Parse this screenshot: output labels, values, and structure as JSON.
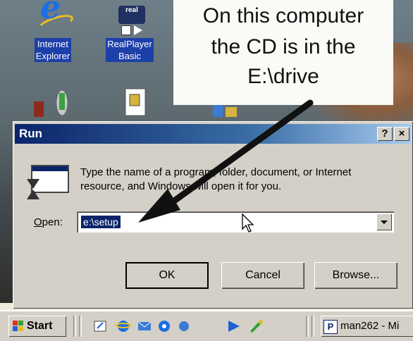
{
  "desktop": {
    "icons": [
      {
        "label_line1": "Internet",
        "label_line2": "Explorer",
        "icon": "internet-explorer-icon"
      },
      {
        "label_line1": "RealPlayer",
        "label_line2": "Basic",
        "icon": "realplayer-icon",
        "badge": "real"
      }
    ]
  },
  "callout": {
    "line1": "On this computer",
    "line2": "the CD is in the",
    "line3": "E:\\drive"
  },
  "run_dialog": {
    "title": "Run",
    "help_label": "?",
    "close_label": "×",
    "description_line1": "Type the name of a program, folder, document, or Internet",
    "description_line2": "resource, and Windows will open it for you.",
    "open_label": "Open:",
    "open_value": "e:\\setup",
    "ok_label": "OK",
    "cancel_label": "Cancel",
    "browse_label": "Browse..."
  },
  "taskbar": {
    "start_label": "Start",
    "task_icon_letter": "P",
    "task_label": "man262 - Mi"
  },
  "colors": {
    "title_bar": "#0a246a",
    "selection": "#0a246a",
    "face": "#d4d0c8"
  }
}
